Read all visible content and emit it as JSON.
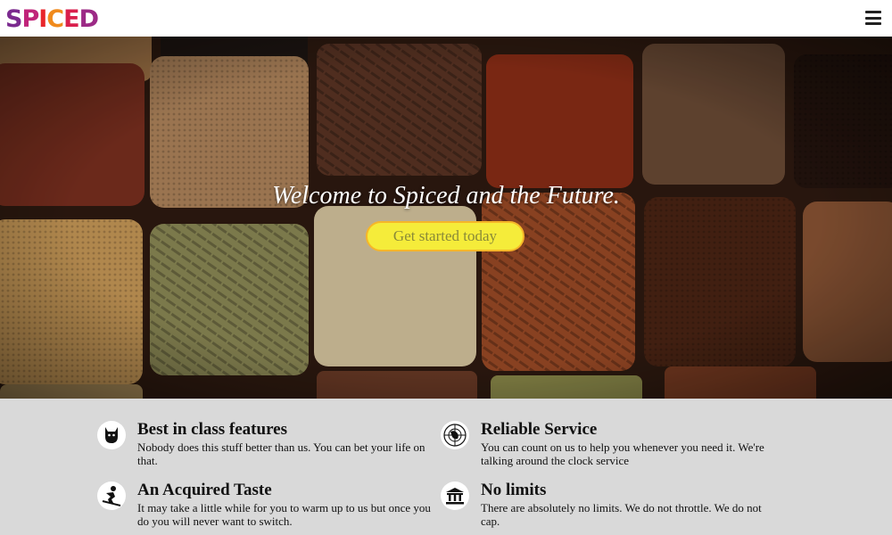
{
  "brand": {
    "name": "SPICED",
    "letters": [
      {
        "ch": "S",
        "color": "#7b2a8f"
      },
      {
        "ch": "P",
        "color": "#c0247a"
      },
      {
        "ch": "I",
        "color": "#e8262b"
      },
      {
        "ch": "C",
        "color": "#f08a1c"
      },
      {
        "ch": "E",
        "color": "#d91f4c"
      },
      {
        "ch": "D",
        "color": "#9c2a86"
      }
    ]
  },
  "header": {
    "menu_icon": "hamburger-menu-icon"
  },
  "hero": {
    "title": "Welcome to Spiced and the Future.",
    "cta_label": "Get started today"
  },
  "features": [
    {
      "icon": "cat-icon",
      "title": "Best in class features",
      "text": "Nobody does this stuff better than us. You can bet your life on that."
    },
    {
      "icon": "globe-icon",
      "title": "Reliable Service",
      "text": "You can count on us to help you whenever you need it. We're talking around the clock service"
    },
    {
      "icon": "skier-icon",
      "title": "An Acquired Taste",
      "text": "It may take a little while for you to warm up to us but once you do you will never want to switch."
    },
    {
      "icon": "bank-icon",
      "title": "No limits",
      "text": "There are absolutely no limits. We do not throttle. We do not cap."
    }
  ],
  "colors": {
    "cta_fill": "#f5ec3a",
    "cta_border": "#f6b628",
    "features_bg": "#d9d9d9"
  }
}
